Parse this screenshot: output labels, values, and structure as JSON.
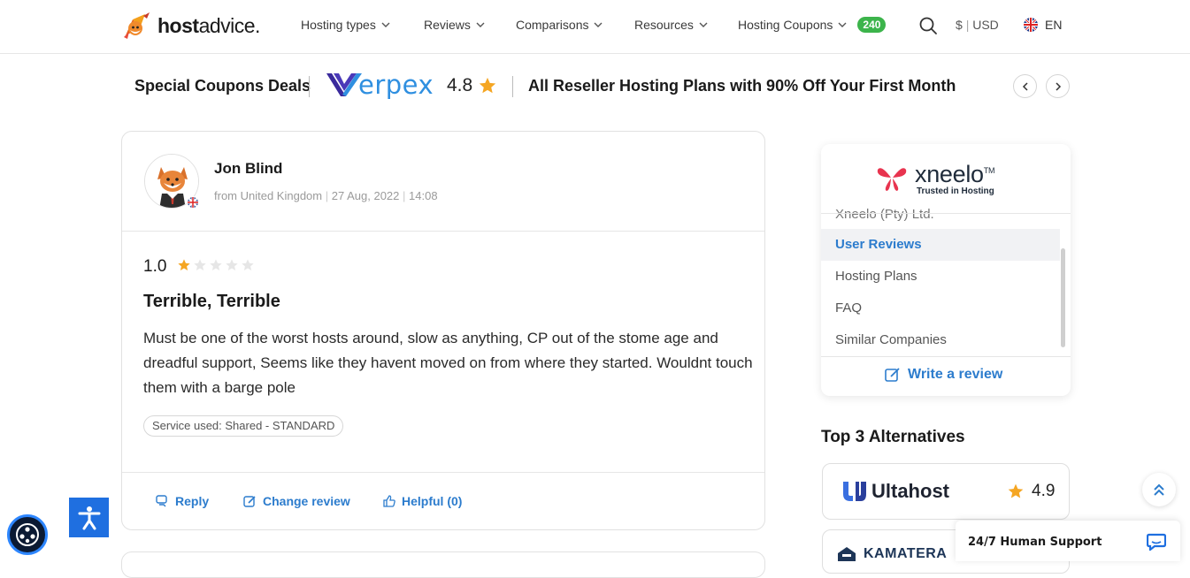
{
  "brand": {
    "name_bold": "host",
    "name_light": "advice.",
    "logo_icon": "fox-rocket-logo-icon"
  },
  "nav": {
    "items": [
      {
        "label": "Hosting types"
      },
      {
        "label": "Reviews"
      },
      {
        "label": "Comparisons"
      },
      {
        "label": "Resources"
      },
      {
        "label": "Hosting Coupons",
        "badge": "240"
      }
    ],
    "currency": {
      "symbol": "$",
      "sep": "|",
      "code": "USD"
    },
    "language": "EN"
  },
  "coupon_bar": {
    "title": "Special Coupons Deals",
    "brand_text": "erpex",
    "rating": "4.8",
    "offer": "All Reseller Hosting Plans with 90% Off Your First Month"
  },
  "review": {
    "reviewer": "Jon Blind",
    "country": "from United Kingdom",
    "date": "27 Aug, 2022",
    "time": "14:08",
    "score": "1.0",
    "stars_filled": 1,
    "stars_total": 5,
    "title": "Terrible, Terrible",
    "body": "Must be one of the worst hosts around, slow as anything, CP out of the stome age and dreadful support, Seems like they havent moved on from where they started. Wouldnt touch them with a barge pole",
    "service": "Service used: Shared - STANDARD",
    "actions": {
      "reply": "Reply",
      "change": "Change review",
      "helpful": "Helpful (0)"
    }
  },
  "sidebar": {
    "company_logo": "xneelo",
    "company_tm": "TM",
    "company_tagline": "Trusted in Hosting",
    "cut_item": "Xneelo (Pty) Ltd.",
    "items": [
      {
        "label": "User Reviews",
        "active": true
      },
      {
        "label": "Hosting Plans"
      },
      {
        "label": "FAQ"
      },
      {
        "label": "Similar Companies"
      }
    ],
    "write_review": "Write a review",
    "alternatives_title": "Top 3 Alternatives",
    "alternatives": [
      {
        "name": "Ultahost",
        "rating": "4.9"
      },
      {
        "name": "KAMATERA"
      }
    ]
  },
  "widgets": {
    "support": "24/7 Human Support"
  },
  "colors": {
    "accent_blue": "#2c7ccd",
    "star_gold": "#f5a623",
    "badge_green": "#3cb44b"
  }
}
